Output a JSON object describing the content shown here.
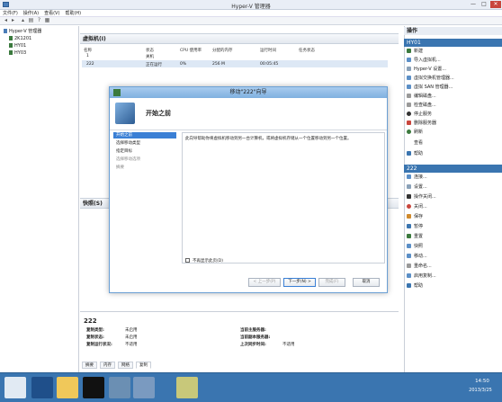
{
  "window": {
    "title": "Hyper-V 管理器",
    "min": "—",
    "max": "□",
    "close": "✕"
  },
  "menu": [
    "文件(F)",
    "操作(A)",
    "查看(V)",
    "帮助(H)"
  ],
  "tree": {
    "root": "Hyper-V 管理器",
    "nodes": [
      "2K1201",
      "HY01",
      "HY03"
    ]
  },
  "vms": {
    "section_title": "虚拟机(I)",
    "columns": [
      "名称",
      "状态",
      "CPU 使用率",
      "分配的内存",
      "运行时间",
      "任务状态"
    ],
    "rows": [
      [
        "1",
        "关机",
        "",
        "",
        "",
        ""
      ],
      [
        "222",
        "正在运行",
        "0%",
        "256 M",
        "00:05:45",
        ""
      ]
    ]
  },
  "snapshots": {
    "title": "快照(S)"
  },
  "details": {
    "name": "222",
    "fields": [
      {
        "k": "复制类型:",
        "v": "未启用"
      },
      {
        "k": "复制状态:",
        "v": "未启用"
      },
      {
        "k": "复制运行状况:",
        "v": "不适用"
      }
    ],
    "fields_right": [
      {
        "k": "当前主服务器:",
        "v": ""
      },
      {
        "k": "当前副本服务器:",
        "v": ""
      },
      {
        "k": "上次同步时间:",
        "v": "不适用"
      }
    ],
    "tabs": [
      "摘要",
      "内存",
      "网络",
      "复制"
    ]
  },
  "dialog": {
    "title": "移动\"222\"向导",
    "heading": "开始之前",
    "nav": [
      "开始之前",
      "选择移动类型",
      "指定目标",
      "选择移动选项",
      "摘要"
    ],
    "text": "此向导帮助你将虚拟机移动到另一台计算机，或将虚拟机存储从一个位置移动到另一个位置。",
    "checkbox": "不再显示此页(D)",
    "buttons": {
      "prev": "< 上一步(P)",
      "next": "下一步(N) >",
      "finish": "完成(F)",
      "cancel": "取消"
    }
  },
  "actions": {
    "title": "操作",
    "host": "HY01",
    "host_items": [
      "新建",
      "导入虚拟机...",
      "Hyper-V 设置...",
      "虚拟交换机管理器...",
      "虚拟 SAN 管理器...",
      "编辑磁盘...",
      "检查磁盘...",
      "停止服务",
      "删除服务器",
      "刷新",
      "查看",
      "帮助"
    ],
    "vm": "222",
    "vm_items": [
      "连接...",
      "设置...",
      "操作关闭...",
      "关闭...",
      "保存",
      "暂停",
      "重置",
      "快照",
      "移动...",
      "重命名...",
      "启用复制...",
      "帮助"
    ]
  },
  "taskbar": {
    "time": "14:50",
    "date": "2013/3/25"
  },
  "colors": {
    "accent": "#3a75b0",
    "selected": "#dde8f5",
    "nav_selected": "#3a7fd5"
  }
}
